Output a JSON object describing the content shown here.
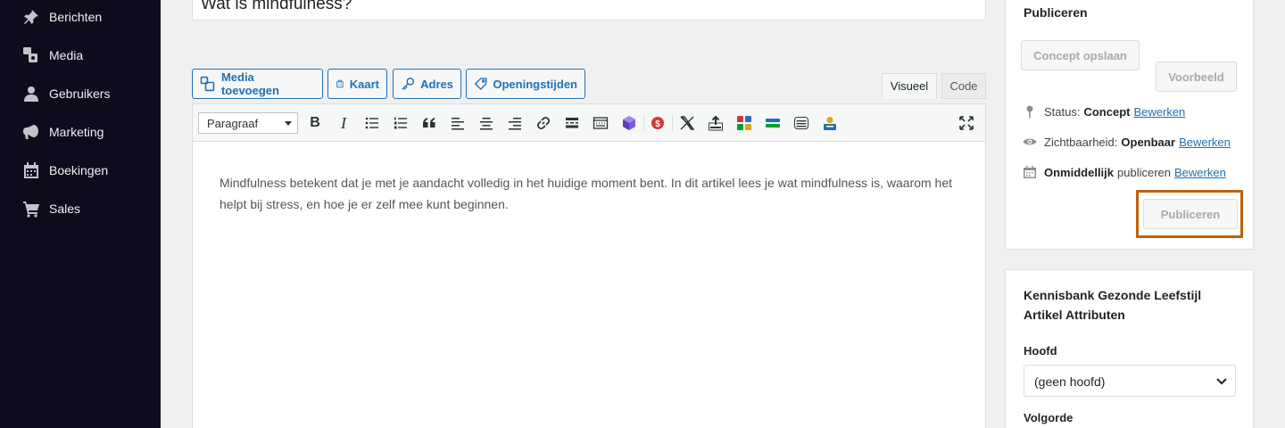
{
  "sidebar": {
    "items": [
      {
        "label": "Berichten",
        "icon": "pin-icon"
      },
      {
        "label": "Media",
        "icon": "media-icon"
      },
      {
        "label": "Gebruikers",
        "icon": "user-icon"
      },
      {
        "label": "Marketing",
        "icon": "megaphone-icon"
      },
      {
        "label": "Boekingen",
        "icon": "calendar-icon"
      },
      {
        "label": "Sales",
        "icon": "cart-icon"
      }
    ]
  },
  "post": {
    "title": "Wat is mindfulness?",
    "content": "Mindfulness betekent dat je met je aandacht volledig in het huidige moment bent. In dit artikel lees je wat mindfulness is, waarom het helpt bij stress, en hoe je er zelf mee kunt beginnen."
  },
  "media_buttons": {
    "add_media": "Media toevoegen",
    "map": "Kaart",
    "address": "Adres",
    "opening_hours": "Openingstijden"
  },
  "editor_tabs": {
    "visual": "Visueel",
    "code": "Code",
    "active": "visual"
  },
  "toolbar": {
    "format": "Paragraaf",
    "bold": "B",
    "italic": "I"
  },
  "publish": {
    "title": "Publiceren",
    "save_draft": "Concept opslaan",
    "preview": "Voorbeeld",
    "status_label": "Status:",
    "status_value": "Concept",
    "visibility_label": "Zichtbaarheid:",
    "visibility_value": "Openbaar",
    "schedule_value": "Onmiddellijk",
    "schedule_label": "publiceren",
    "edit_link": "Bewerken",
    "publish_button": "Publiceren",
    "highlight_color": "#c0610a"
  },
  "attributes": {
    "title": "Kennisbank Gezonde Leefstijl Artikel Attributen",
    "parent_label": "Hoofd",
    "parent_value": "(geen hoofd)",
    "order_label": "Volgorde"
  },
  "colors": {
    "sidebar_bg": "#0d0c1d",
    "accent": "#2271b1",
    "background": "#f0f0f1"
  }
}
